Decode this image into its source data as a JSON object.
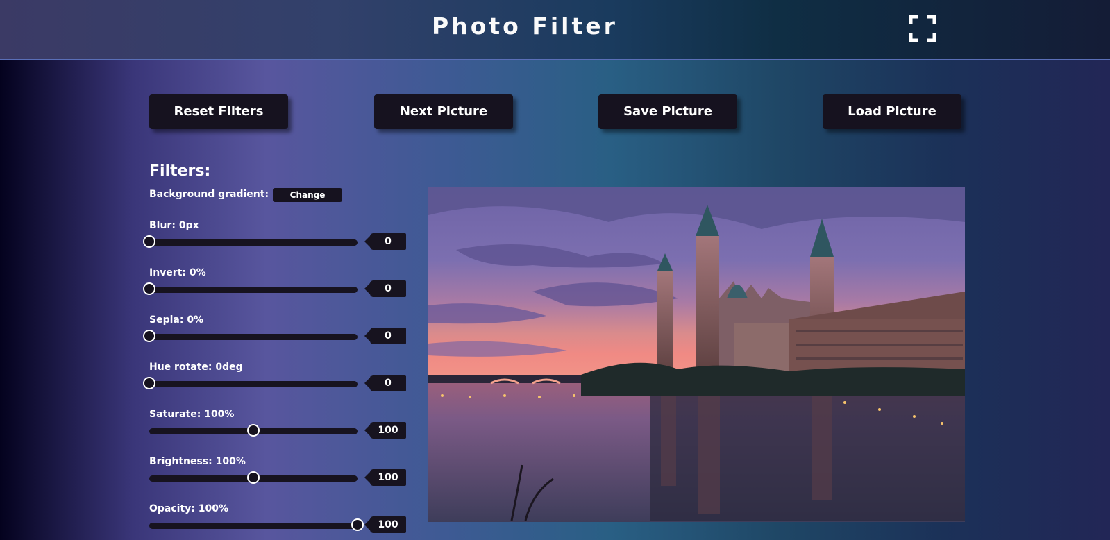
{
  "header": {
    "title": "Photo Filter",
    "fullscreen_icon": "fullscreen-icon"
  },
  "toolbar": {
    "reset_label": "Reset Filters",
    "next_label": "Next Picture",
    "save_label": "Save Picture",
    "load_label": "Load Picture"
  },
  "filters": {
    "title": "Filters:",
    "background_label": "Background gradient:",
    "change_label": "Change",
    "items": [
      {
        "label": "Blur: 0px",
        "value": "0",
        "level": 0
      },
      {
        "label": "Invert: 0%",
        "value": "0",
        "level": 0
      },
      {
        "label": "Sepia: 0%",
        "value": "0",
        "level": 0
      },
      {
        "label": "Hue rotate: 0deg",
        "value": "0",
        "level": 0
      },
      {
        "label": "Saturate: 100%",
        "value": "100",
        "level": 0.5
      },
      {
        "label": "Brightness: 100%",
        "value": "100",
        "level": 0.5
      },
      {
        "label": "Opacity: 100%",
        "value": "100",
        "level": 1
      }
    ]
  },
  "colors": {
    "button_bg": "#16121f",
    "accent_line": "#5a6fb8"
  }
}
